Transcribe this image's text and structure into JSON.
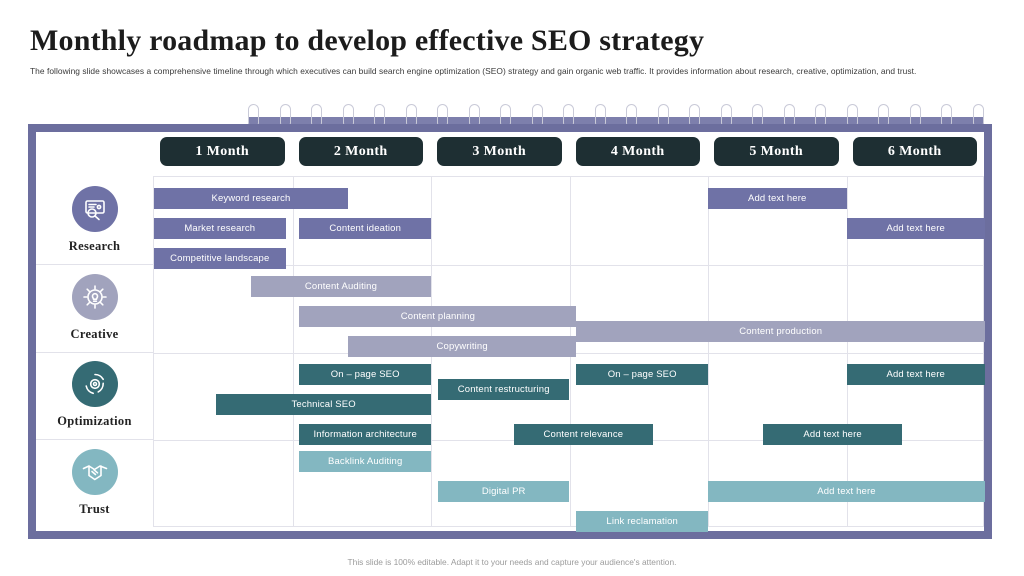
{
  "header": {
    "title": "Monthly roadmap to develop effective SEO strategy",
    "subtitle": "The following slide showcases a comprehensive timeline through which executives can build search engine optimization (SEO) strategy and gain organic web traffic. It provides information about research, creative, optimization, and trust."
  },
  "footer": {
    "note": "This slide is 100% editable. Adapt it to your needs and capture your audience's attention."
  },
  "colors": {
    "frame_border": "#6c6e9e",
    "binding": "#7d7fac",
    "month_pill": "#1e2f33",
    "research": "#6f72a6",
    "creative": "#a1a3bd",
    "optimization": "#356b74",
    "trust": "#83b7c1",
    "grid_line": "#e2e2ea"
  },
  "months": [
    {
      "label": "1 Month"
    },
    {
      "label": "2 Month"
    },
    {
      "label": "3 Month"
    },
    {
      "label": "4 Month"
    },
    {
      "label": "5 Month"
    },
    {
      "label": "6 Month"
    }
  ],
  "categories": [
    {
      "label": "Research",
      "icon": "research-monitor-icon",
      "color": "#6f72a6"
    },
    {
      "label": "Creative",
      "icon": "lightbulb-gear-icon",
      "color": "#a1a3bd"
    },
    {
      "label": "Optimization",
      "icon": "optimization-cycle-icon",
      "color": "#356b74"
    },
    {
      "label": "Trust",
      "icon": "handshake-icon",
      "color": "#83b7c1"
    }
  ],
  "chart_data": {
    "type": "bar",
    "title": "Monthly roadmap to develop effective SEO strategy",
    "xlabel": "",
    "ylabel": "",
    "categories": [
      "1 Month",
      "2 Month",
      "3 Month",
      "4 Month",
      "5 Month",
      "6 Month"
    ],
    "legend_position": "left",
    "grid": true,
    "tasks": [
      {
        "row": "Research",
        "label": "Keyword research",
        "start_month": 1.0,
        "end_month": 2.4,
        "lane": 0,
        "color": "#6f72a6"
      },
      {
        "row": "Research",
        "label": "Market research",
        "start_month": 1.0,
        "end_month": 1.95,
        "lane": 1,
        "color": "#6f72a6"
      },
      {
        "row": "Research",
        "label": "Content ideation",
        "start_month": 2.05,
        "end_month": 3.0,
        "lane": 1,
        "color": "#6f72a6"
      },
      {
        "row": "Research",
        "label": "Competitive landscape",
        "start_month": 1.0,
        "end_month": 1.95,
        "lane": 2,
        "color": "#6f72a6"
      },
      {
        "row": "Research",
        "label": "Add text here",
        "start_month": 5.0,
        "end_month": 6.0,
        "lane": 0,
        "color": "#6f72a6"
      },
      {
        "row": "Research",
        "label": "Add text here",
        "start_month": 6.0,
        "end_month": 7.0,
        "lane": 1,
        "color": "#6f72a6"
      },
      {
        "row": "Creative",
        "label": "Content Auditing",
        "start_month": 1.7,
        "end_month": 3.0,
        "lane": 0,
        "color": "#a1a3bd"
      },
      {
        "row": "Creative",
        "label": "Content planning",
        "start_month": 2.05,
        "end_month": 4.05,
        "lane": 1,
        "color": "#a1a3bd"
      },
      {
        "row": "Creative",
        "label": "Copywriting",
        "start_month": 2.4,
        "end_month": 4.05,
        "lane": 2,
        "color": "#a1a3bd"
      },
      {
        "row": "Creative",
        "label": "Content production",
        "start_month": 4.05,
        "end_month": 7.0,
        "lane": 1.5,
        "color": "#a1a3bd"
      },
      {
        "row": "Optimization",
        "label": "On – page SEO",
        "start_month": 2.05,
        "end_month": 3.0,
        "lane": 0,
        "color": "#356b74"
      },
      {
        "row": "Optimization",
        "label": "Technical SEO",
        "start_month": 1.45,
        "end_month": 3.0,
        "lane": 1,
        "color": "#356b74"
      },
      {
        "row": "Optimization",
        "label": "Information architecture",
        "start_month": 2.05,
        "end_month": 3.0,
        "lane": 2,
        "color": "#356b74"
      },
      {
        "row": "Optimization",
        "label": "Content restructuring",
        "start_month": 3.05,
        "end_month": 4.0,
        "lane": 0.5,
        "color": "#356b74"
      },
      {
        "row": "Optimization",
        "label": "Content relevance",
        "start_month": 3.6,
        "end_month": 4.6,
        "lane": 2,
        "color": "#356b74"
      },
      {
        "row": "Optimization",
        "label": "On – page SEO",
        "start_month": 4.05,
        "end_month": 5.0,
        "lane": 0,
        "color": "#356b74"
      },
      {
        "row": "Optimization",
        "label": "Add text here",
        "start_month": 6.0,
        "end_month": 7.0,
        "lane": 0,
        "color": "#356b74"
      },
      {
        "row": "Optimization",
        "label": "Add text here",
        "start_month": 5.4,
        "end_month": 6.4,
        "lane": 2,
        "color": "#356b74"
      },
      {
        "row": "Trust",
        "label": "Backlink Auditing",
        "start_month": 2.05,
        "end_month": 3.0,
        "lane": 0,
        "color": "#83b7c1"
      },
      {
        "row": "Trust",
        "label": "Digital PR",
        "start_month": 3.05,
        "end_month": 4.0,
        "lane": 1,
        "color": "#83b7c1"
      },
      {
        "row": "Trust",
        "label": "Link reclamation",
        "start_month": 4.05,
        "end_month": 5.0,
        "lane": 2,
        "color": "#83b7c1"
      },
      {
        "row": "Trust",
        "label": "Add text here",
        "start_month": 5.0,
        "end_month": 7.0,
        "lane": 1,
        "color": "#83b7c1"
      }
    ]
  }
}
